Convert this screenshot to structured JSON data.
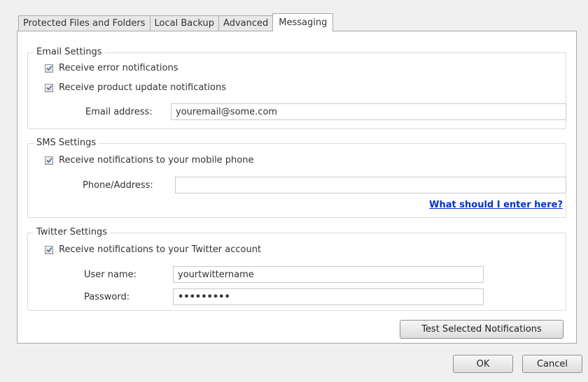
{
  "tabs": [
    {
      "label": "Protected Files and Folders",
      "active": false
    },
    {
      "label": "Local Backup",
      "active": false
    },
    {
      "label": "Advanced",
      "active": false
    },
    {
      "label": "Messaging",
      "active": true
    }
  ],
  "email": {
    "title": "Email Settings",
    "error_label": "Receive error notifications",
    "error_checked": true,
    "update_label": "Receive product update notifications",
    "update_checked": true,
    "address_label": "Email address:",
    "address_value": "youremail@some.com"
  },
  "sms": {
    "title": "SMS Settings",
    "mobile_label": "Receive notifications to your mobile phone",
    "mobile_checked": true,
    "phone_label": "Phone/Address:",
    "phone_value": "",
    "help_link": "What should I enter here?"
  },
  "twitter": {
    "title": "Twitter Settings",
    "account_label": "Receive notifications to your Twitter account",
    "account_checked": true,
    "username_label": "User name:",
    "username_value": "yourtwittername",
    "password_label": "Password:",
    "password_value": "•••••••••"
  },
  "buttons": {
    "test": "Test Selected Notifications",
    "ok": "OK",
    "cancel": "Cancel"
  },
  "icons": {
    "checkbox": "checkmark-icon"
  },
  "colors": {
    "link": "#0033cc",
    "panel_bg": "#ffffff",
    "window_bg": "#f0f0f0"
  }
}
